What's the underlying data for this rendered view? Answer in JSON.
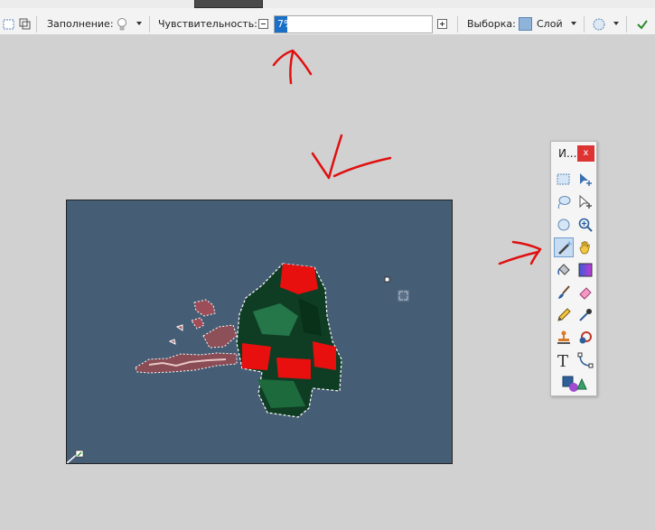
{
  "toolbar": {
    "fill_label": "Заполнение:",
    "sensitivity_label": "Чувствительность:",
    "sensitivity_value": "7%",
    "sensitivity_fraction": 0.07,
    "selection_label": "Выборка:",
    "layer_label": "Слой"
  },
  "tools_panel": {
    "title": "И...",
    "close_label": "x",
    "tools": [
      "rectangle-select",
      "move-selected",
      "lasso-select",
      "move-selection",
      "ellipse-select",
      "zoom",
      "magic-wand",
      "pan",
      "paint-bucket",
      "gradient",
      "paintbrush",
      "eraser",
      "pencil",
      "color-picker",
      "clone-stamp",
      "recolor",
      "text",
      "line-curve",
      "shapes"
    ],
    "active_tool": "magic-wand"
  },
  "colors": {
    "app_background": "#d1d1d1",
    "canvas_background": "#465e75",
    "annotation_red": "#e01010",
    "accent_blue": "#1a6fc7"
  }
}
